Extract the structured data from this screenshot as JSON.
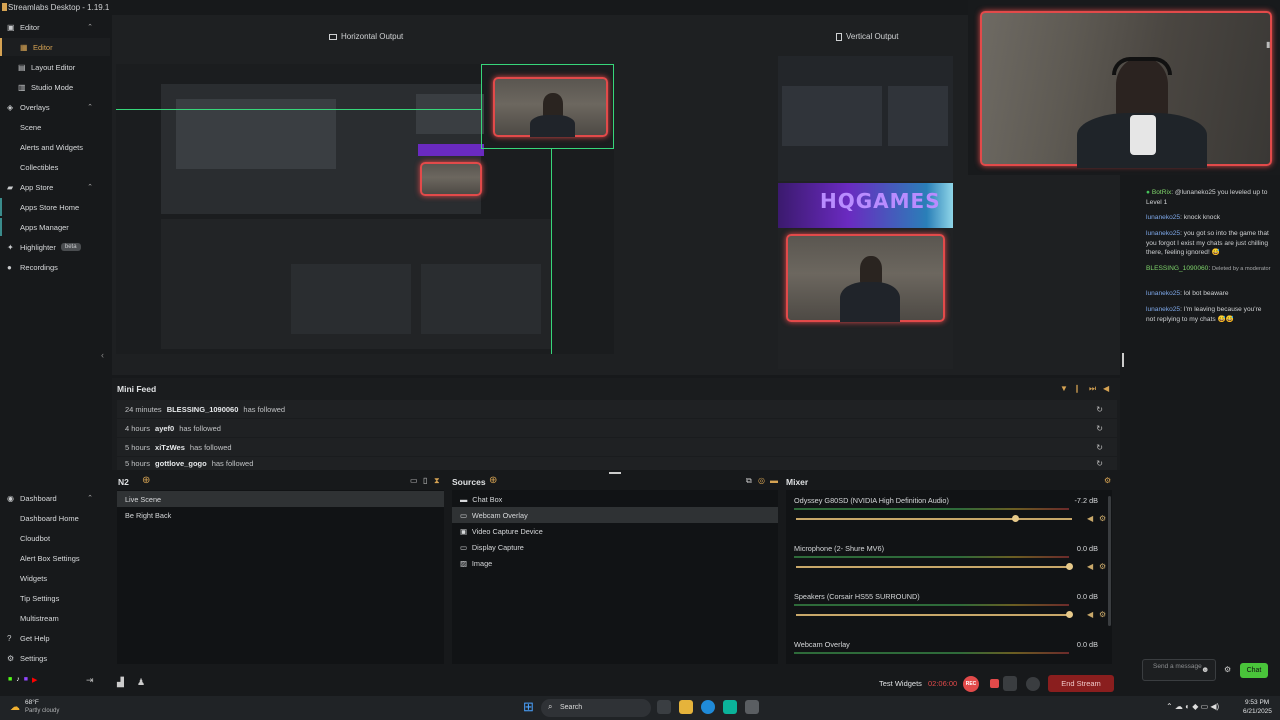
{
  "app": {
    "title": "Streamlabs Desktop - 1.19.1"
  },
  "sidebar": {
    "items": [
      {
        "label": "Editor",
        "icon": "editor-icon"
      },
      {
        "label": "Editor",
        "icon": "scene-editor-icon"
      },
      {
        "label": "Layout Editor",
        "icon": "layout-icon"
      },
      {
        "label": "Studio Mode",
        "icon": "studio-icon"
      },
      {
        "label": "Overlays",
        "icon": "overlays-icon"
      },
      {
        "label": "Scene"
      },
      {
        "label": "Alerts and Widgets"
      },
      {
        "label": "Collectibles"
      },
      {
        "label": "App Store",
        "icon": "app-store-icon"
      },
      {
        "label": "Apps Store Home"
      },
      {
        "label": "Apps Manager"
      },
      {
        "label": "Highlighter",
        "badge": "beta"
      },
      {
        "label": "Recordings"
      },
      {
        "label": "Dashboard"
      },
      {
        "label": "Dashboard Home"
      },
      {
        "label": "Cloudbot"
      },
      {
        "label": "Alert Box Settings"
      },
      {
        "label": "Widgets"
      },
      {
        "label": "Tip Settings"
      },
      {
        "label": "Multistream"
      },
      {
        "label": "Get Help"
      },
      {
        "label": "Settings"
      }
    ]
  },
  "outputs": {
    "horizontal": "Horizontal Output",
    "vertical": "Vertical Output"
  },
  "banner": {
    "text": "HQGAMES"
  },
  "chat": {
    "messages": [
      {
        "user": "BotRix",
        "text": ": @lunaneko25 you leveled up to Level 1",
        "note": ""
      },
      {
        "user": "lunaneko25",
        "text": ": knock knock",
        "note": ""
      },
      {
        "user": "lunaneko25",
        "text": ": you got so into the game that you forgot I exist my chats are just chilling there, feeling ignored! 😅",
        "note": ""
      },
      {
        "user": "BLESSING_1090060",
        "text": ":",
        "note": "Deleted by a moderator"
      },
      {
        "user": "lunaneko25",
        "text": ": lol bot beaware",
        "note": ""
      },
      {
        "user": "lunaneko25",
        "text": ": I'm leaving because you're not replying to my chats 😅😅",
        "note": ""
      }
    ],
    "input_placeholder": "Send a message",
    "send_label": "Chat"
  },
  "minifeed": {
    "title": "Mini Feed",
    "rows": [
      {
        "time": "24 minutes",
        "user": "BLESSING_1090060",
        "action": "has followed"
      },
      {
        "time": "4 hours",
        "user": "ayef0",
        "action": "has followed"
      },
      {
        "time": "5 hours",
        "user": "xiTzWes",
        "action": "has followed"
      },
      {
        "time": "5 hours",
        "user": "gottlove_gogo",
        "action": "has followed"
      }
    ]
  },
  "scenes": {
    "title": "N2",
    "items": [
      "Live Scene",
      "Be Right Back"
    ]
  },
  "sources": {
    "title": "Sources",
    "items": [
      {
        "label": "Chat Box",
        "icon": "chat-icon"
      },
      {
        "label": "Webcam Overlay",
        "icon": "browser-icon"
      },
      {
        "label": "Video Capture Device",
        "icon": "camera-icon"
      },
      {
        "label": "Display Capture",
        "icon": "monitor-icon"
      },
      {
        "label": "Image",
        "icon": "image-icon"
      }
    ]
  },
  "mixer": {
    "title": "Mixer",
    "items": [
      {
        "name": "Odyssey G80SD (NVIDIA High Definition Audio)",
        "db": "-7.2 dB",
        "level": 0.8
      },
      {
        "name": "Microphone (2- Shure MV6)",
        "db": "0.0 dB",
        "level": 1.0
      },
      {
        "name": "Speakers (Corsair HS55 SURROUND)",
        "db": "0.0 dB",
        "level": 1.0
      },
      {
        "name": "Webcam Overlay",
        "db": "0.0 dB",
        "level": 1.0
      }
    ]
  },
  "footer": {
    "test_widgets": "Test Widgets",
    "timer": "02:06:00",
    "rec": "REC",
    "end_stream": "End Stream"
  },
  "taskbar": {
    "weather_temp": "68°F",
    "weather_desc": "Partly cloudy",
    "search": "Search",
    "time": "9:53 PM",
    "date": "6/21/2025"
  },
  "colors": {
    "accent": "#d6a353",
    "live_red": "#e24a4a",
    "chat_green": "#49c43a",
    "end_stream": "#8a1e1e"
  }
}
